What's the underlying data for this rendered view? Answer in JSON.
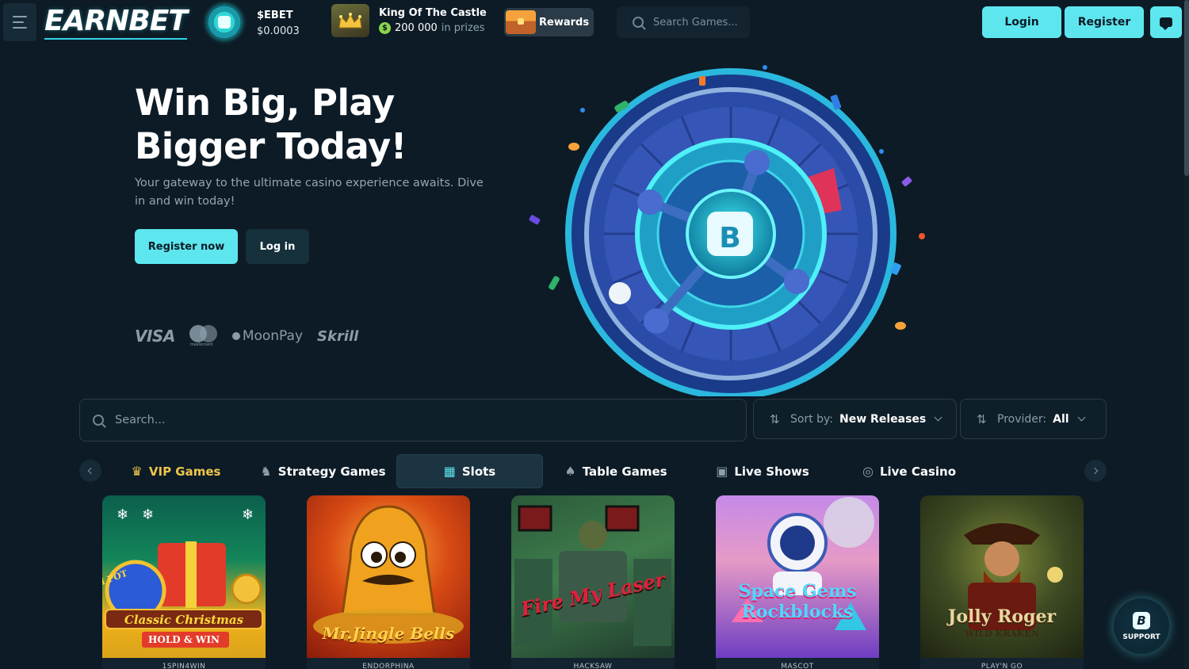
{
  "header": {
    "logo_text": "EARNBET",
    "token": {
      "name": "$EBET",
      "price": "$0.0003"
    },
    "king": {
      "title": "King Of The Castle",
      "prize_amount": "200 000",
      "prize_suffix": "in prizes",
      "prize_symbol": "$"
    },
    "rewards_label": "Rewards",
    "search_placeholder": "Search Games...",
    "login_label": "Login",
    "register_label": "Register"
  },
  "hero": {
    "title": "Win Big, Play Bigger Today!",
    "subtitle": "Your gateway to the ultimate casino experience awaits. Dive in and win today!",
    "register_label": "Register now",
    "login_label": "Log in",
    "payments": {
      "visa": "VISA",
      "mastercard_caption": "mastercard",
      "moonpay": "MoonPay",
      "skrill": "Skrill"
    }
  },
  "filters": {
    "search_placeholder": "Search...",
    "sort_label": "Sort by:",
    "sort_value": "New Releases",
    "provider_label": "Provider:",
    "provider_value": "All"
  },
  "tabs": [
    {
      "label": "VIP Games",
      "icon": "crown-icon"
    },
    {
      "label": "Strategy Games",
      "icon": "chess-knight-icon"
    },
    {
      "label": "Slots",
      "icon": "slot-machine-icon",
      "active": true
    },
    {
      "label": "Table Games",
      "icon": "cards-icon"
    },
    {
      "label": "Live Shows",
      "icon": "tv-icon"
    },
    {
      "label": "Live Casino",
      "icon": "chip-icon"
    }
  ],
  "games": [
    {
      "title": "Classic Christmas",
      "subtitle": "HOLD & WIN",
      "badge": "MINI POT",
      "provider": "1SPIN4WIN"
    },
    {
      "title": "Mr.Jingle Bells",
      "provider": "ENDORPHINA"
    },
    {
      "title": "Fire My Laser",
      "provider": "HACKSAW"
    },
    {
      "title": "Space Gems Rockblocks",
      "provider": "MASCOT"
    },
    {
      "title": "Jolly Roger",
      "subtitle": "WILD KRAKEN",
      "provider": "PLAY'N GO"
    }
  ],
  "support_label": "SUPPORT",
  "colors": {
    "accent": "#5ee6ef",
    "background": "#0c1b26",
    "vip": "#f0c64a"
  }
}
